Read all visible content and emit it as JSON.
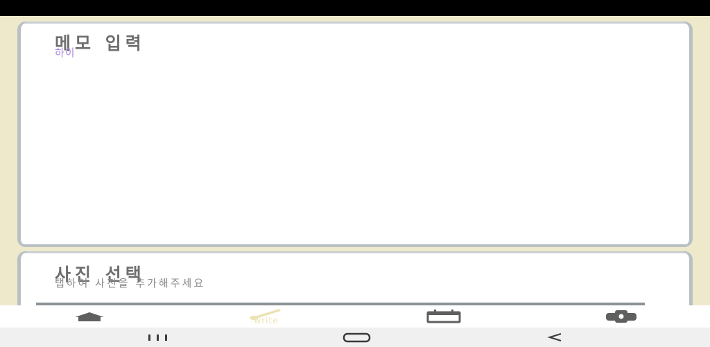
{
  "memo": {
    "title": "메모 입력",
    "value": "하이"
  },
  "photo": {
    "title": "사진 선택",
    "hint": "탭하여 사진을 추가해주세요"
  },
  "bottom_nav": {
    "items": [
      {
        "icon": "home-icon"
      },
      {
        "icon": "brush-icon",
        "label": "write",
        "active": true
      },
      {
        "icon": "calendar-icon"
      },
      {
        "icon": "gear-icon"
      }
    ]
  },
  "colors": {
    "background": "#efe9cb",
    "card": "#ffffff",
    "card_border": "#b9c0c4",
    "title_text": "#6e6e6e",
    "memo_text": "#a98be0",
    "hint_text": "#8a8a8a",
    "nav_icon": "#5f5f5f",
    "active_label": "#ece2b4"
  }
}
